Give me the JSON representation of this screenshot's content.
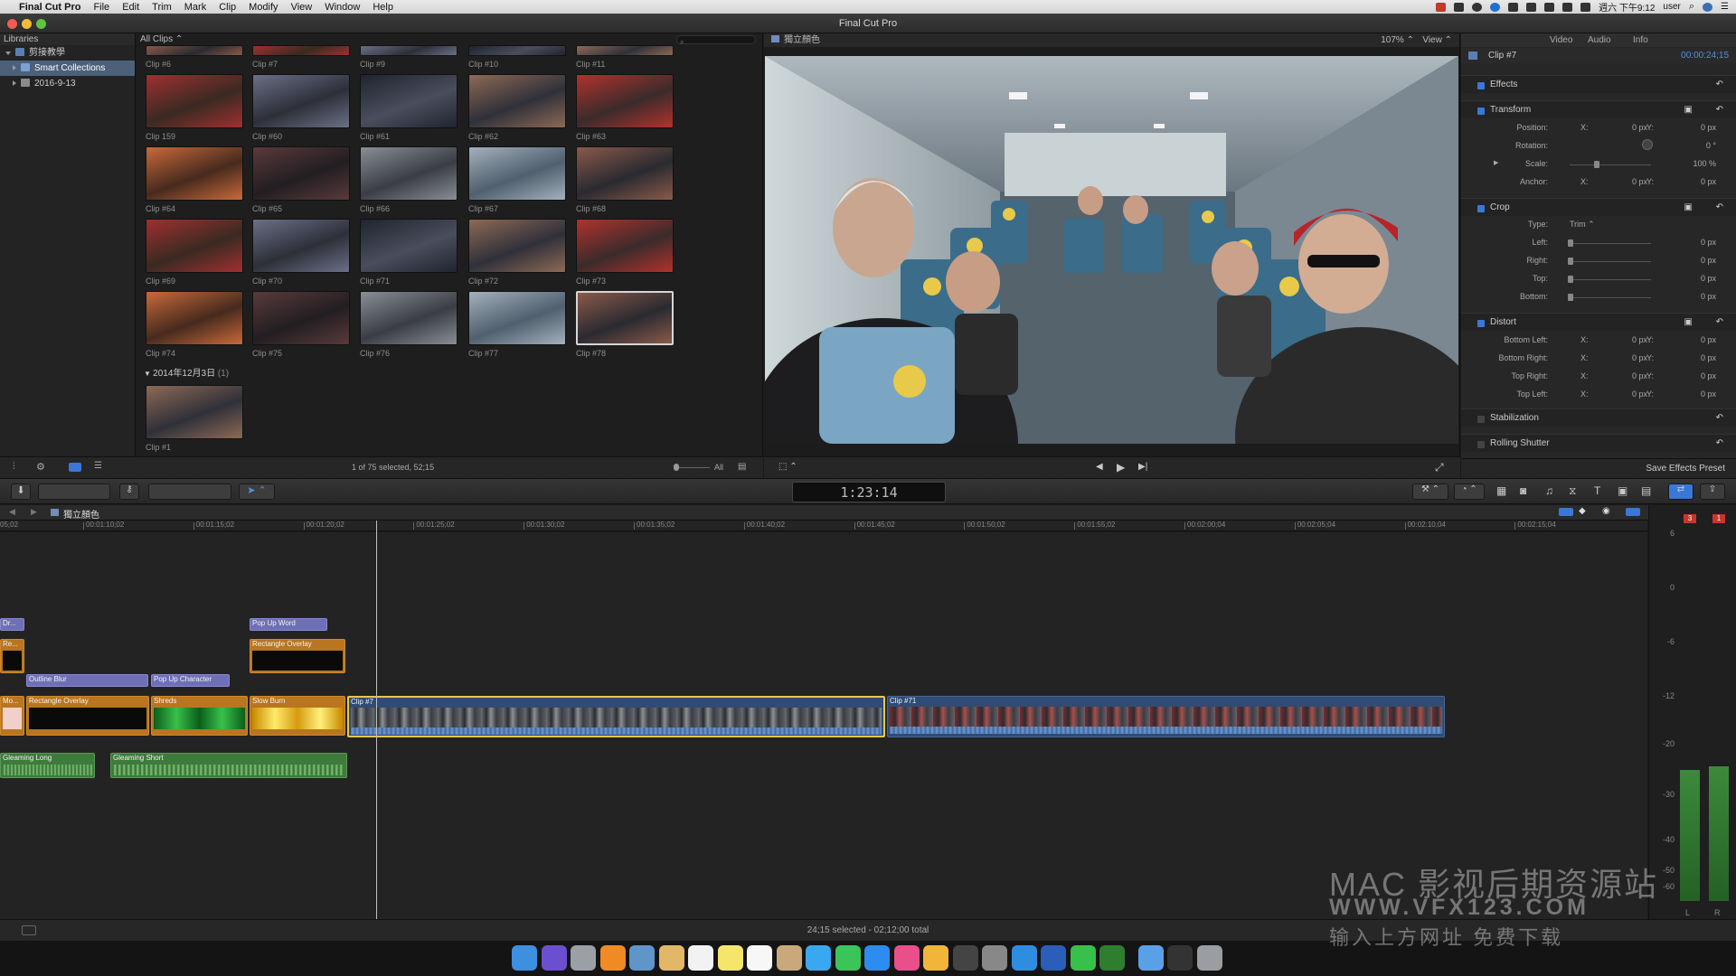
{
  "menu": {
    "apple": "",
    "app": "Final Cut Pro",
    "items": [
      "File",
      "Edit",
      "Trim",
      "Mark",
      "Clip",
      "Modify",
      "View",
      "Window",
      "Help"
    ],
    "clock": "週六 下午9:12",
    "user": "user"
  },
  "window": {
    "title": "Final Cut Pro"
  },
  "libraries": {
    "header": "Libraries",
    "items": [
      {
        "label": "剪接教學",
        "expanded": true
      },
      {
        "label": "Smart Collections",
        "selected": true
      },
      {
        "label": "2016-9-13"
      }
    ]
  },
  "browser": {
    "filter": "All Clips",
    "top_row": [
      "Clip #6",
      "Clip #7",
      "Clip #9",
      "Clip #10",
      "Clip #11"
    ],
    "rows": [
      [
        "Clip 159",
        "Clip #60",
        "Clip #61",
        "Clip #62",
        "Clip #63"
      ],
      [
        "Clip #64",
        "Clip #65",
        "Clip #66",
        "Clip #67",
        "Clip #68"
      ],
      [
        "Clip #69",
        "Clip #70",
        "Clip #71",
        "Clip #72",
        "Clip #73"
      ],
      [
        "Clip #74",
        "Clip #75",
        "Clip #76",
        "Clip #77",
        "Clip #78"
      ]
    ],
    "date_group": "2014年12月3日",
    "date_count": "(1)",
    "last_clip": "Clip #1",
    "status": "1 of 75 selected, 52;15",
    "all": "All"
  },
  "viewer": {
    "name": "獨立顏色",
    "zoom": "107%",
    "view": "View"
  },
  "inspector": {
    "tabs": [
      "Video",
      "Audio",
      "Info"
    ],
    "clip": "Clip #7",
    "duration": "00:00:24;15",
    "sections": {
      "effects": "Effects",
      "transform": "Transform",
      "crop": "Crop",
      "distort": "Distort",
      "stabilization": "Stabilization",
      "rolling": "Rolling Shutter"
    },
    "transform": {
      "position": "Position:",
      "rotation": "Rotation:",
      "scale": "Scale:",
      "anchor": "Anchor:",
      "pos_x": "0 px",
      "pos_y": "0 px",
      "rot": "0 °",
      "scale_val": "100 %",
      "anc_x": "0 px",
      "anc_y": "0 px",
      "scale_level": 0.3
    },
    "crop": {
      "type_label": "Type:",
      "type": "Trim",
      "left": "Left:",
      "right": "Right:",
      "top": "Top:",
      "bottom": "Bottom:",
      "val": "0 px"
    },
    "distort": {
      "bl": "Bottom Left:",
      "br": "Bottom Right:",
      "tr": "Top Right:",
      "tl": "Top Left:",
      "val": "0 px"
    },
    "x": "X:",
    "y": "Y:",
    "save": "Save Effects Preset"
  },
  "toolbar": {
    "timecode": "1:23:14"
  },
  "timeline": {
    "project": "獨立顏色",
    "ruler": [
      "00:01:10;02",
      "00:01:15;02",
      "00:01:20;02",
      "00:01:25;02",
      "00:01:30;02",
      "00:01:35;02",
      "00:01:40;02",
      "00:01:45;02",
      "00:01:50;02",
      "00:01:55;02",
      "00:02:00;04",
      "00:02:05;04",
      "00:02:10;04",
      "00:02:15;04"
    ],
    "clips": {
      "dr": "Dr...",
      "re": "Re...",
      "mo": "Mo...",
      "popupword": "Pop Up Word",
      "rect1": "Rectangle Overlay",
      "outline": "Outline Blur",
      "popupchar": "Pop Up Character",
      "rect2": "Rectangle Overlay",
      "shreds": "Shreds",
      "slowburn": "Slow Burn",
      "clip7": "Clip #7",
      "clip71": "Clip #71",
      "glong": "Gleaming Long",
      "gshort": "Gleaming Short"
    },
    "status": "24;15 selected - 02;12;00 total"
  },
  "meters": {
    "peak_l": "3",
    "peak_r": "1",
    "scale": [
      "6",
      "0",
      "-6",
      "-12",
      "-20",
      "-30",
      "-40",
      "-50",
      "-60"
    ],
    "l": "L",
    "r": "R"
  },
  "watermark": {
    "line1": "MAC 影视后期资源站",
    "line2": "WWW.VFX123.COM",
    "line3": "输入上方网址 免费下载"
  }
}
